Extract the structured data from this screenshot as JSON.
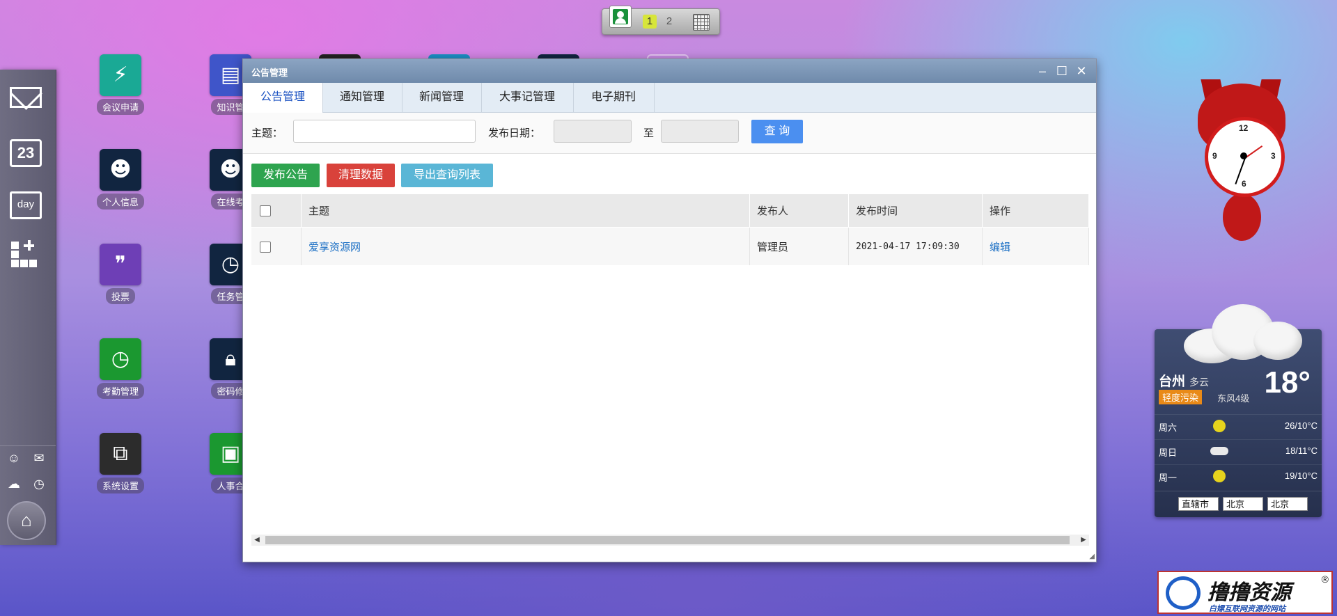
{
  "switcher": {
    "pages": [
      "1",
      "2"
    ],
    "active_page": "1"
  },
  "dock": {
    "calendar_day": "23",
    "day_label": "day"
  },
  "desktop_icons": [
    {
      "label": "会议申请",
      "color": "#1aa995"
    },
    {
      "label": "知识管",
      "color": "#3f55c9"
    },
    {
      "label": "个人信息",
      "color": "#112540"
    },
    {
      "label": "在线考",
      "color": "#112540"
    },
    {
      "label": "投票",
      "color": "#6e3fb6"
    },
    {
      "label": "任务管",
      "color": "#112540"
    },
    {
      "label": "考勤管理",
      "color": "#1b9830"
    },
    {
      "label": "密码修",
      "color": "#112540"
    },
    {
      "label": "系统设置",
      "color": "#2c2c2c"
    },
    {
      "label": "人事合",
      "color": "#1b9830"
    }
  ],
  "window": {
    "title": "公告管理",
    "tabs": [
      "公告管理",
      "通知管理",
      "新闻管理",
      "大事记管理",
      "电子期刊"
    ],
    "active_tab": "公告管理",
    "search": {
      "subject_label": "主题：",
      "subject_value": "",
      "date_label": "发布日期：",
      "date_to": "至",
      "query_button": "查 询"
    },
    "actions": {
      "publish": "发布公告",
      "clear": "清理数据",
      "export": "导出查询列表"
    },
    "table": {
      "columns": [
        "主题",
        "发布人",
        "发布时间",
        "操作"
      ],
      "rows": [
        {
          "subject": "爱享资源网",
          "publisher": "管理员",
          "time": "2021-04-17 17:09:30",
          "action": "编辑"
        }
      ]
    }
  },
  "clock": {
    "numbers": [
      "12",
      "3",
      "6",
      "9"
    ]
  },
  "weather": {
    "city": "台州",
    "condition": "多云",
    "temp": "18°",
    "air_quality": "轻度污染",
    "wind": "东风4级",
    "forecast": [
      {
        "day": "周六",
        "range": "26/10°C",
        "icon": "sun-icon"
      },
      {
        "day": "周日",
        "range": "18/11°C",
        "icon": "cloud-icon"
      },
      {
        "day": "周一",
        "range": "19/10°C",
        "icon": "sun-icon"
      }
    ],
    "selects": [
      "直辖市",
      "北京",
      "北京"
    ]
  },
  "logo": {
    "text": "撸撸资源",
    "subtitle": "白嫖互联网资源的网站",
    "reg": "®"
  },
  "colors": {
    "accent_blue": "#4b8ff0",
    "publish_green": "#2ea44f",
    "clear_red": "#d9423b",
    "export_cyan": "#5ab6d6"
  }
}
